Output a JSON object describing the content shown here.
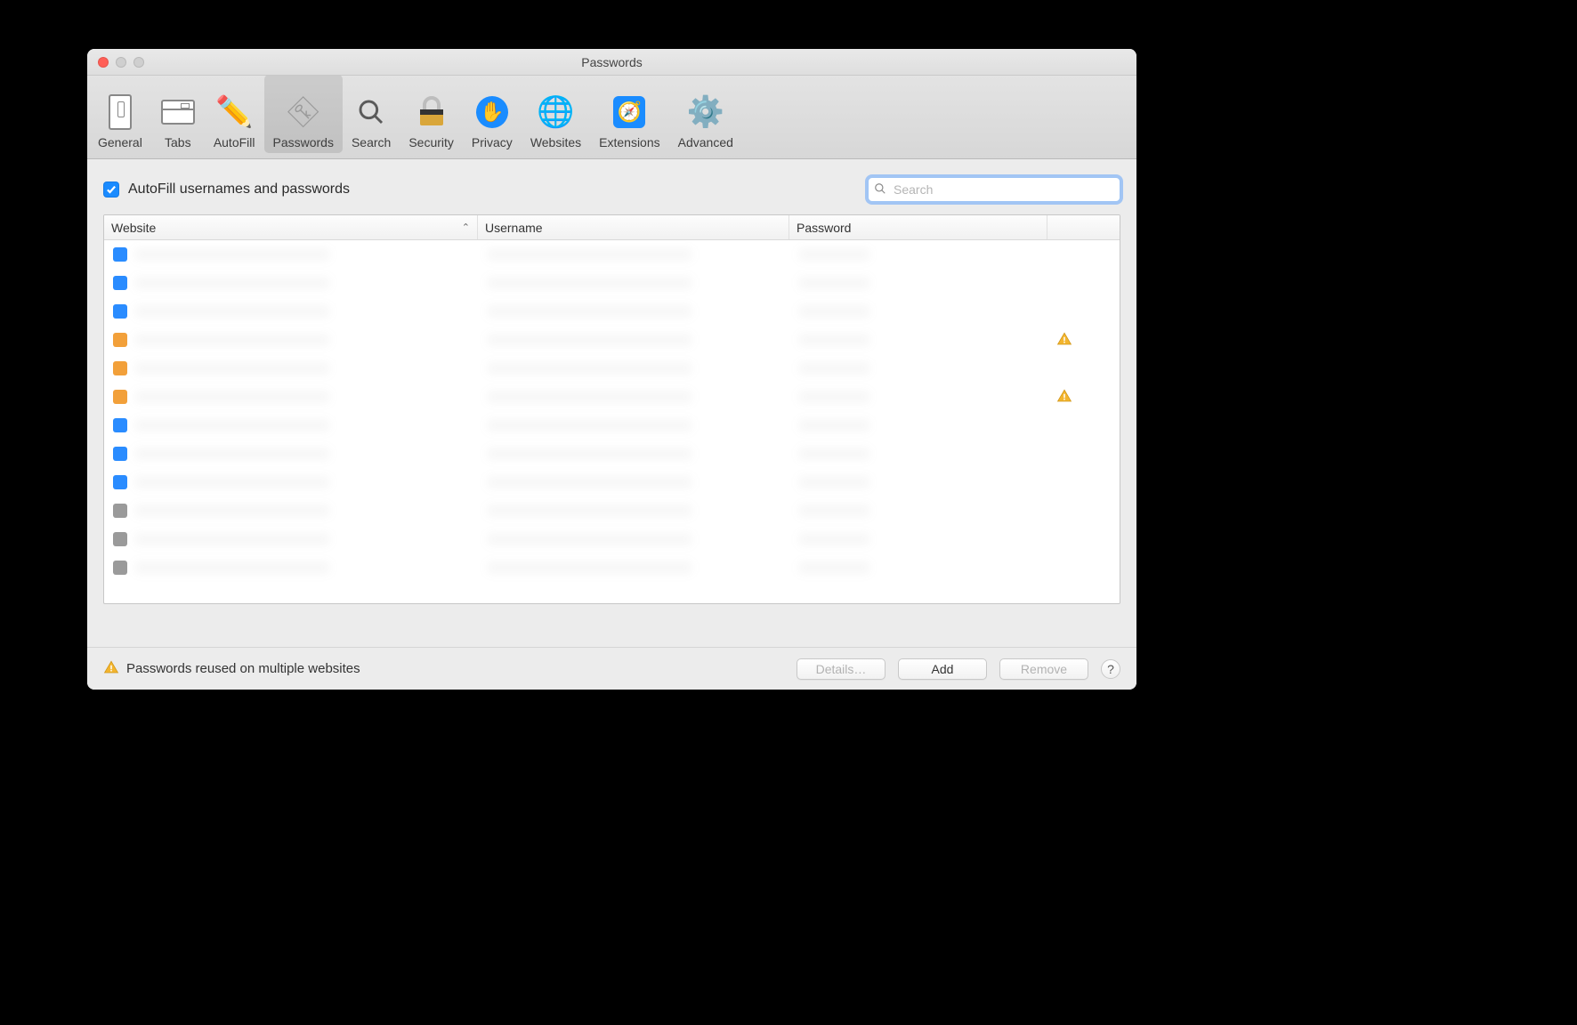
{
  "window": {
    "title": "Passwords"
  },
  "toolbar": {
    "items": [
      {
        "id": "general",
        "label": "General",
        "active": false
      },
      {
        "id": "tabs",
        "label": "Tabs",
        "active": false
      },
      {
        "id": "autofill",
        "label": "AutoFill",
        "active": false
      },
      {
        "id": "passwords",
        "label": "Passwords",
        "active": true
      },
      {
        "id": "search",
        "label": "Search",
        "active": false
      },
      {
        "id": "security",
        "label": "Security",
        "active": false
      },
      {
        "id": "privacy",
        "label": "Privacy",
        "active": false
      },
      {
        "id": "websites",
        "label": "Websites",
        "active": false
      },
      {
        "id": "extensions",
        "label": "Extensions",
        "active": false
      },
      {
        "id": "advanced",
        "label": "Advanced",
        "active": false
      }
    ]
  },
  "autofill_checkbox": {
    "checked": true,
    "label": "AutoFill usernames and passwords"
  },
  "search": {
    "placeholder": "Search",
    "value": ""
  },
  "table": {
    "columns": {
      "website": "Website",
      "username": "Username",
      "password": "Password"
    },
    "sort_column": "website",
    "rows": [
      {
        "fav": "blue",
        "warn": false
      },
      {
        "fav": "blue",
        "warn": false
      },
      {
        "fav": "blue",
        "warn": false
      },
      {
        "fav": "orange",
        "warn": true
      },
      {
        "fav": "orange",
        "warn": false
      },
      {
        "fav": "orange",
        "warn": true
      },
      {
        "fav": "blue",
        "warn": false
      },
      {
        "fav": "blue",
        "warn": false
      },
      {
        "fav": "blue",
        "warn": false
      },
      {
        "fav": "grey",
        "warn": false
      },
      {
        "fav": "grey",
        "warn": false
      },
      {
        "fav": "grey",
        "warn": false
      }
    ]
  },
  "footer": {
    "warning_text": "Passwords reused on multiple websites",
    "details_label": "Details…",
    "add_label": "Add",
    "remove_label": "Remove"
  }
}
